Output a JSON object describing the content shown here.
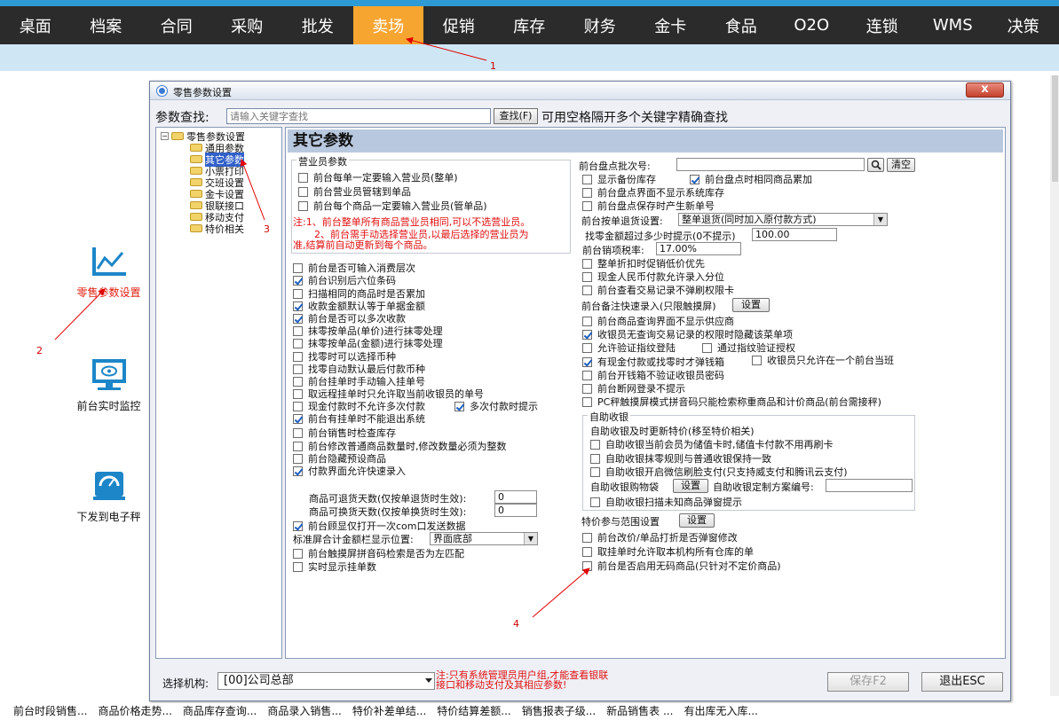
{
  "menubar": {
    "items": [
      "桌面",
      "档案",
      "合同",
      "采购",
      "批发",
      "卖场",
      "促销",
      "库存",
      "财务",
      "金卡",
      "食品",
      "O2O",
      "连锁",
      "WMS",
      "决策"
    ],
    "active_index": 5,
    "accent_color": "#f7a531"
  },
  "leftnav": {
    "items": [
      {
        "label": "零售参数设置",
        "icon": "line-chart-icon",
        "active": true
      },
      {
        "label": "前台实时监控",
        "icon": "monitor-icon",
        "active": false
      },
      {
        "label": "下发到电子秤",
        "icon": "scale-icon",
        "active": false
      }
    ]
  },
  "dialog": {
    "title": "零售参数设置",
    "close_label": "x",
    "search": {
      "label": "参数查找:",
      "placeholder": "请输入关键字查找",
      "button": "查找(F)",
      "hint": "可用空格隔开多个关键字精确查找"
    },
    "tree": {
      "root": "零售参数设置",
      "children": [
        "通用参数",
        "其它参数",
        "小票打印",
        "交班设置",
        "金卡设置",
        "银联接口",
        "移动支付",
        "特价相关"
      ],
      "selected_index": 1
    },
    "content_title": "其它参数",
    "left": {
      "group_title": "营业员参数",
      "group_items": [
        {
          "label": "前台每单一定要输入营业员(整单)",
          "checked": false
        },
        {
          "label": "前台营业员管辖到单品",
          "checked": false
        },
        {
          "label": "前台每个商品一定要输入营业员(管单品)",
          "checked": false
        }
      ],
      "note_line1": "注:1、前台整单所有商品营业员相同,可以不选营业员。",
      "note_line2": "2、前台需手动选择营业员,以最后选择的营业员为",
      "note_line3": "准,结算前自动更新到每个商品。",
      "items": [
        {
          "label": "前台是否可输入消费层次",
          "checked": false
        },
        {
          "label": "前台识别后六位条码",
          "checked": true
        },
        {
          "label": "扫描相同的商品时是否累加",
          "checked": false
        },
        {
          "label": "收款金额默认等于单据金额",
          "checked": true
        },
        {
          "label": "前台是否可以多次收款",
          "checked": true
        },
        {
          "label": "抹零按单品(单价)进行抹零处理",
          "checked": false
        },
        {
          "label": "抹零按单品(金额)进行抹零处理",
          "checked": false
        },
        {
          "label": "找零时可以选择币种",
          "checked": false
        },
        {
          "label": "找零自动默认最后付款币种",
          "checked": false
        },
        {
          "label": "前台挂单时手动输入挂单号",
          "checked": false
        },
        {
          "label": "取远程挂单时只允许取当前收银员的单号",
          "checked": false
        },
        {
          "label": "现金付款时不允许多次付款",
          "checked": false
        },
        {
          "label": "前台有挂单时不能退出系统",
          "checked": true
        },
        {
          "label": "前台销售时检查库存",
          "checked": false
        },
        {
          "label": "前台修改普通商品数量时,修改数量必须为整数",
          "checked": false
        },
        {
          "label": "前台隐藏预设商品",
          "checked": false
        },
        {
          "label": "付款界面允许快速录入",
          "checked": true
        }
      ],
      "multi_pay_hint": {
        "label": "多次付款时提示",
        "checked": true
      },
      "return_days_label": "商品可退货天数(仅按单退货时生效):",
      "return_days_value": "0",
      "exchange_days_label": "商品可换货天数(仅按单换货时生效):",
      "exchange_days_value": "0",
      "bottom_items": [
        {
          "label": "前台顾显仅打开一次com口发送数据",
          "checked": true
        }
      ],
      "total_pos_label": "标准屏合计金额栏显示位置:",
      "total_pos_value": "界面底部",
      "bottom_items2": [
        {
          "label": "前台触摸屏拼音码检索是否为左匹配",
          "checked": false
        },
        {
          "label": "实时显示挂单数",
          "checked": false
        }
      ]
    },
    "right": {
      "batch_label": "前台盘点批次号:",
      "batch_value": "",
      "clear_button": "清空",
      "items1": [
        {
          "label": "显示备份库存",
          "checked": false
        },
        {
          "label": "前台盘点界面不显示系统库存",
          "checked": false
        },
        {
          "label": "前台盘点保存时产生新单号",
          "checked": false
        }
      ],
      "accumulate": {
        "label": "前台盘点时相同商品累加",
        "checked": true
      },
      "return_setting_label": "前台按单退货设置:",
      "return_setting_value": "整单退货(同时加入原付款方式)",
      "change_limit_label": "找零金额超过多少时提示(0不提示)",
      "change_limit_value": "100.00",
      "tax_label": "前台销项税率:",
      "tax_value": "17.00%",
      "items2": [
        {
          "label": "整单折扣时促销低价优先",
          "checked": false
        },
        {
          "label": "现金人民币付款允许录入分位",
          "checked": false
        },
        {
          "label": "前台查看交易记录不弹刷权限卡",
          "checked": false
        }
      ],
      "memo_label": "前台备注快速录入(只限触摸屏)",
      "memo_button": "设置",
      "items3": [
        {
          "label": "前台商品查询界面不显示供应商",
          "checked": false
        },
        {
          "label": "收银员无查询交易记录的权限时隐藏该菜单项",
          "checked": true
        },
        {
          "label": "允许验证指纹登陆",
          "checked": false
        }
      ],
      "fp_auth": {
        "label": "通过指纹验证授权",
        "checked": false
      },
      "cash_drawer": {
        "label": "有现金付款或找零时才弹钱箱",
        "checked": true
      },
      "single_pos": {
        "label": "收银员只允许在一个前台当班",
        "checked": false
      },
      "items4": [
        {
          "label": "前台开钱箱不验证收银员密码",
          "checked": false
        },
        {
          "label": "前台断网登录不提示",
          "checked": false
        },
        {
          "label": "PC秤触摸屏模式拼音码只能检索称重商品和计价商品(前台需接秤)",
          "checked": false
        }
      ],
      "self_group_title": "自助收银",
      "self_sub_title": "自助收银及时更新特价(移至特价相关)",
      "self_items": [
        {
          "label": "自助收银当前会员为储值卡时,储值卡付款不用再刷卡",
          "checked": false
        },
        {
          "label": "自助收银抹零规则与普通收银保持一致",
          "checked": false
        },
        {
          "label": "自助收银开启微信刷脸支付(只支持威支付和腾讯云支付)",
          "checked": false
        }
      ],
      "self_bag_label": "自助收银购物袋",
      "self_bag_button": "设置",
      "self_plan_label": "自助收银定制方案编号:",
      "self_plan_value": "",
      "self_unknown": {
        "label": "自助收银扫描未知商品弹窗提示",
        "checked": false
      },
      "special_label": "特价参与范围设置",
      "special_button": "设置",
      "items5": [
        {
          "label": "前台改价/单品打折是否弹窗修改",
          "checked": false
        },
        {
          "label": "取挂单时允许取本机构所有仓库的单",
          "checked": false
        },
        {
          "label": "前台是否启用无码商品(只针对不定价商品)",
          "checked": false
        }
      ]
    },
    "bottom": {
      "org_label": "选择机构:",
      "org_value": "[00]公司总部",
      "note_line1": "注:只有系统管理员用户组,才能查看银联",
      "note_line2": "接口和移动支付及其相应参数!",
      "save_button": "保存F2",
      "exit_button": "退出ESC"
    }
  },
  "statusbar": {
    "items": [
      "前台时段销售...",
      "商品价格走势...",
      "商品库存查询...",
      "商品录入销售...",
      "特价补差单结...",
      "特价结算差额...",
      "销售报表子级...",
      "新品销售表 ...",
      "有出库无入库..."
    ]
  },
  "annotations": [
    "1",
    "2",
    "3",
    "4"
  ]
}
